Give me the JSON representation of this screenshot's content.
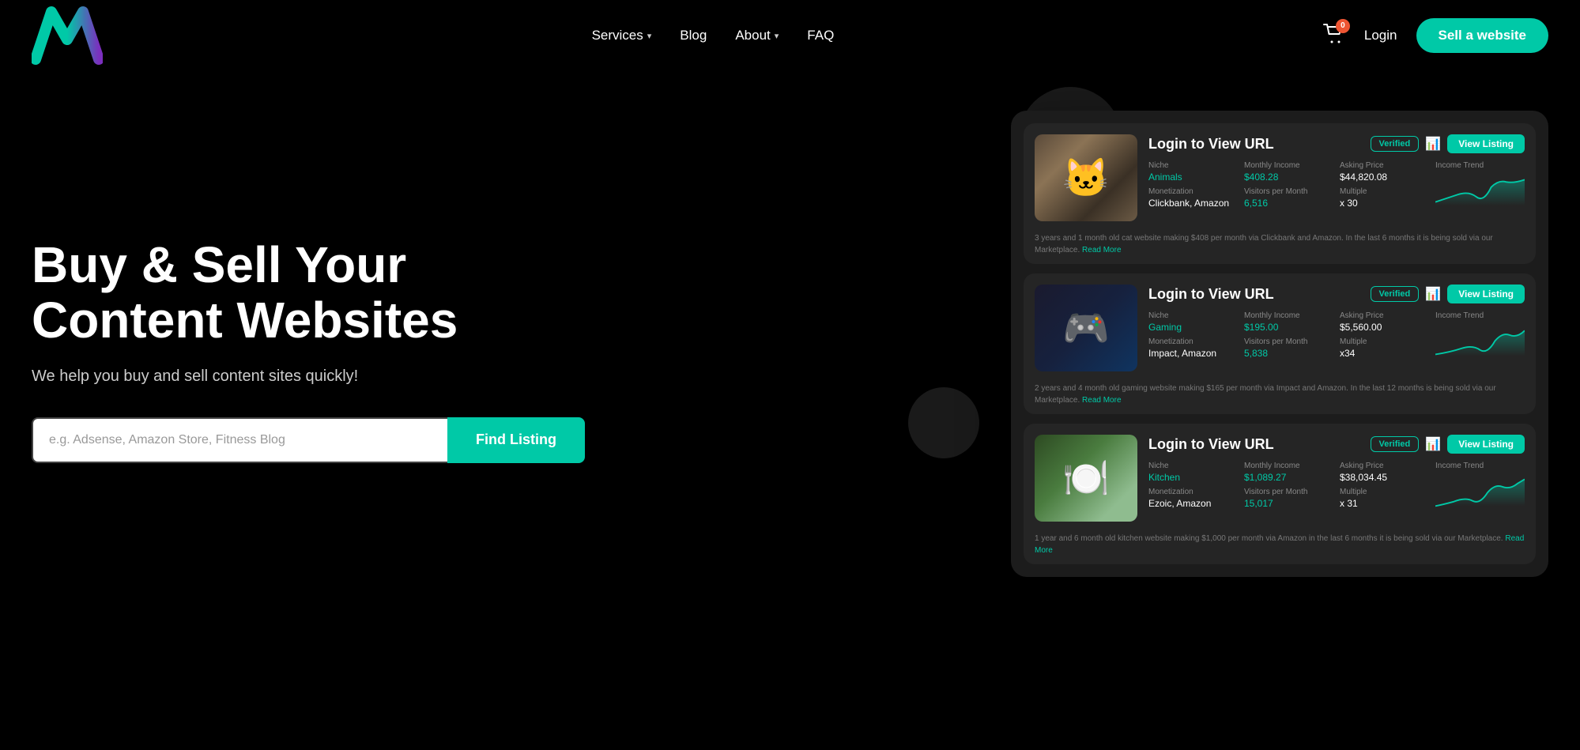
{
  "nav": {
    "logo_alt": "Marketsy Logo",
    "links": [
      {
        "label": "Services",
        "has_dropdown": true
      },
      {
        "label": "Blog",
        "has_dropdown": false
      },
      {
        "label": "About",
        "has_dropdown": true
      },
      {
        "label": "FAQ",
        "has_dropdown": false
      }
    ],
    "cart_count": "0",
    "login_label": "Login",
    "sell_label": "Sell a website"
  },
  "hero": {
    "title": "Buy & Sell Your Content Websites",
    "subtitle": "We help you buy and sell content sites quickly!",
    "search_placeholder": "e.g. Adsense, Amazon Store, Fitness Blog",
    "find_btn_label": "Find Listing"
  },
  "listings": [
    {
      "title": "Login to View URL",
      "niche_label": "Niche",
      "niche_value": "Animals",
      "monthly_income_label": "Monthly Income",
      "monthly_income_value": "$408.28",
      "asking_price_label": "Asking Price",
      "asking_price_value": "$44,820.08",
      "monetization_label": "Monetization",
      "monetization_value": "Clickbank, Amazon",
      "visitors_label": "Visitors per Month",
      "visitors_value": "6,516",
      "multiple_label": "Multiple",
      "multiple_value": "x 30",
      "income_trend_label": "Income Trend",
      "description": "3 years and 1 month old cat website making $408 per month via Clickbank and Amazon. In the last 6 months it is being sold via our Marketplace.",
      "read_more": "Read More",
      "img_class": "img-cat"
    },
    {
      "title": "Login to View URL",
      "niche_label": "Niche",
      "niche_value": "Gaming",
      "monthly_income_label": "Monthly Income",
      "monthly_income_value": "$195.00",
      "asking_price_label": "Asking Price",
      "asking_price_value": "$5,560.00",
      "monetization_label": "Monetization",
      "monetization_value": "Impact, Amazon",
      "visitors_label": "Visitors per Month",
      "visitors_value": "5,838",
      "multiple_label": "Multiple",
      "multiple_value": "x34",
      "income_trend_label": "Income Trend",
      "description": "2 years and 4 month old gaming website making $165 per month via Impact and Amazon. In the last 12 months is being sold via our Marketplace.",
      "read_more": "Read More",
      "img_class": "img-gaming"
    },
    {
      "title": "Login to View URL",
      "niche_label": "Niche",
      "niche_value": "Kitchen",
      "monthly_income_label": "Monthly Income",
      "monthly_income_value": "$1,089.27",
      "asking_price_label": "Asking Price",
      "asking_price_value": "$38,034.45",
      "monetization_label": "Monetization",
      "monetization_value": "Ezoic, Amazon",
      "visitors_label": "Visitors per Month",
      "visitors_value": "15,017",
      "multiple_label": "Multiple",
      "multiple_value": "x 31",
      "income_trend_label": "Income Trend",
      "description": "1 year and 6 month old kitchen website making $1,000 per month via Amazon in the last 6 months it is being sold via our Marketplace.",
      "read_more": "Read More",
      "img_class": "img-kitchen"
    }
  ],
  "colors": {
    "accent": "#00c9a7",
    "verified": "#00c9a7",
    "chart_line": "#00c9a7",
    "warning": "#ff6b35"
  }
}
